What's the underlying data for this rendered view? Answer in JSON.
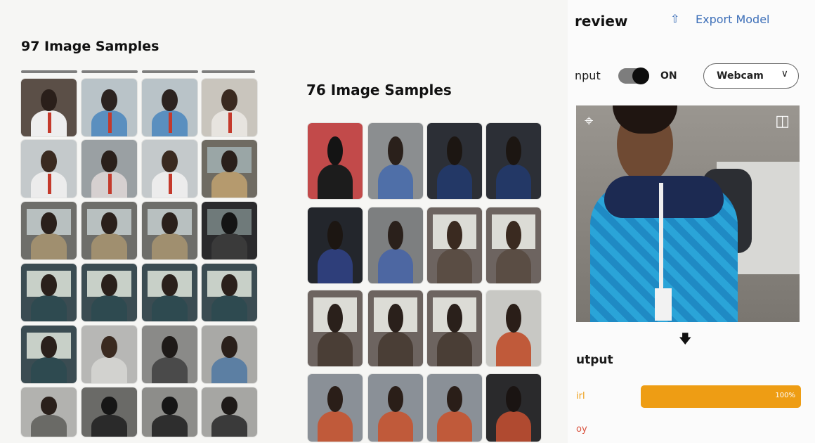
{
  "dataset1": {
    "title": "97 Image Samples",
    "rows": 6,
    "cols": 4
  },
  "dataset2": {
    "title": "76 Image Samples",
    "rows": 4,
    "cols": 4
  },
  "preview": {
    "title": "review",
    "export_label": "Export Model",
    "input_label": "nput",
    "toggle_state": "ON",
    "webcam_label": "Webcam",
    "output_title": "utput",
    "classes": [
      {
        "label": "irl",
        "percent_text": "100%",
        "value": 1.0,
        "color": "#ee9d14"
      },
      {
        "label": "oy",
        "percent_text": "",
        "value": 0.0,
        "color": "#d9533f"
      }
    ]
  },
  "colors": {
    "accent": "#3d6fb8",
    "bar": "#ee9d14"
  }
}
